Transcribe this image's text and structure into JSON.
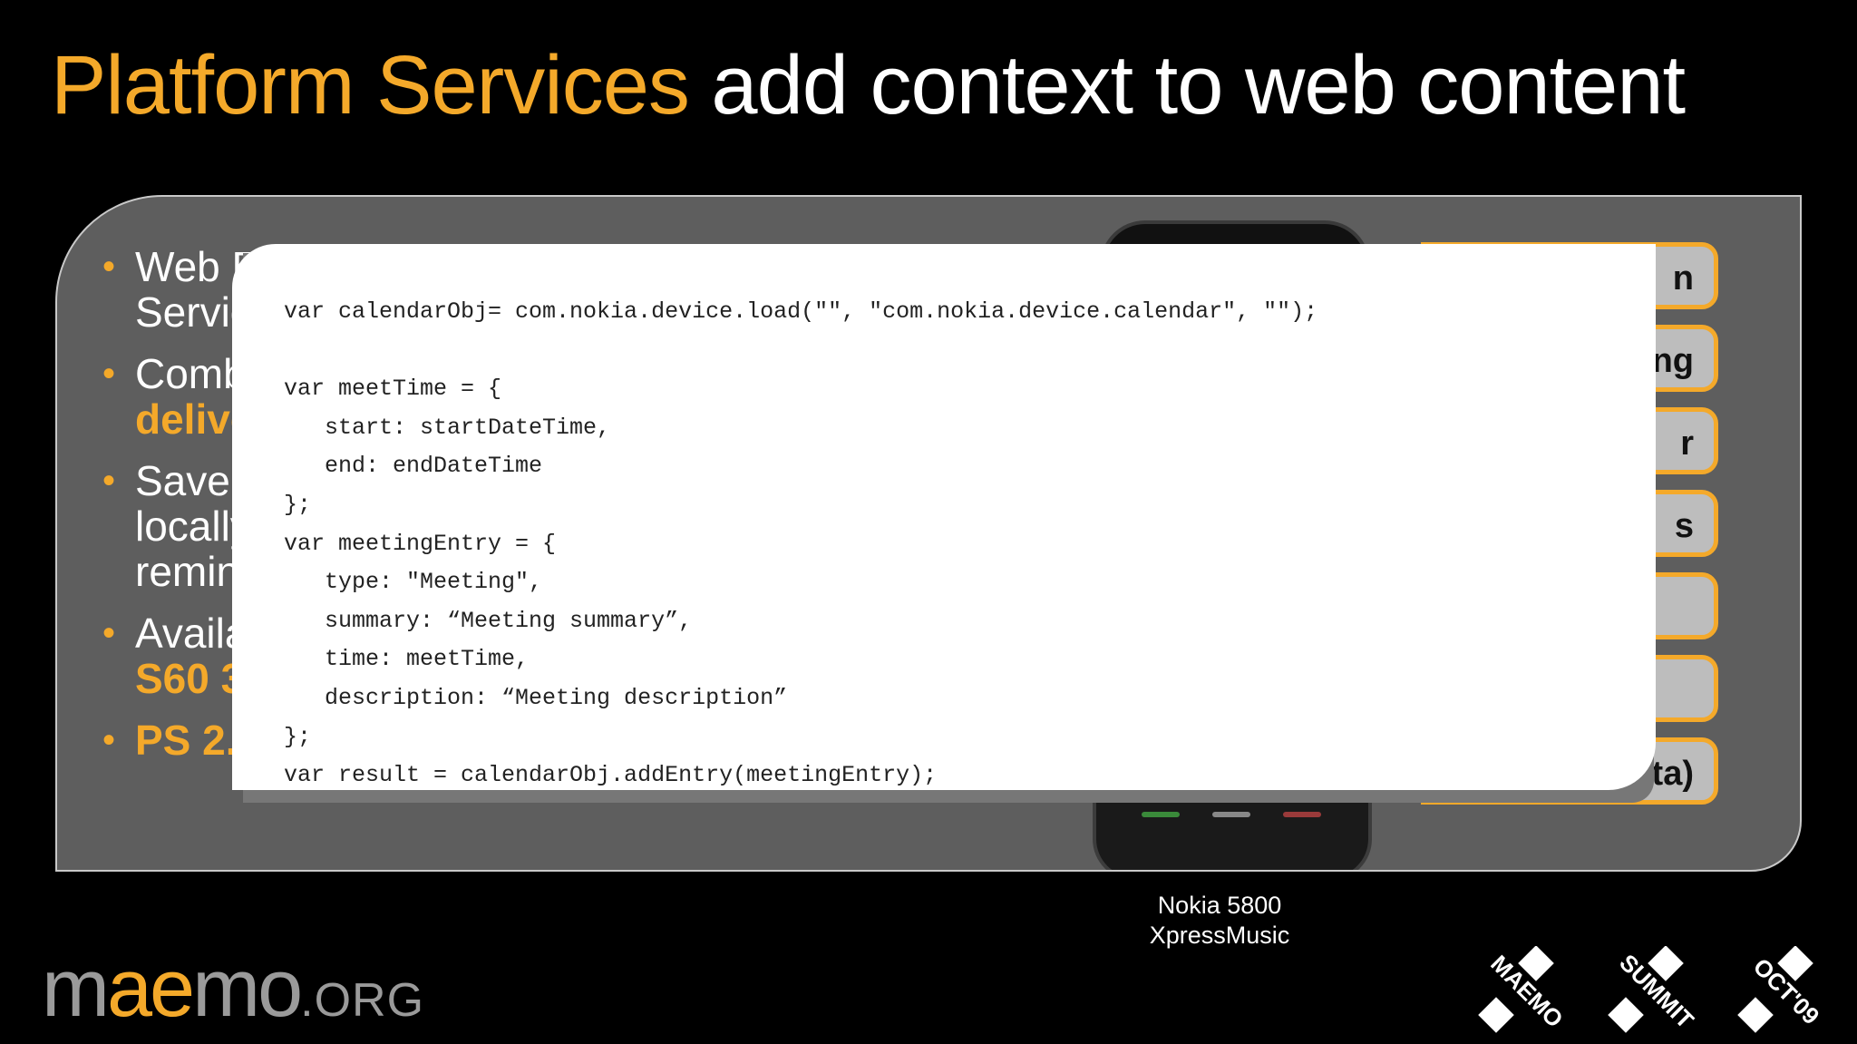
{
  "slide": {
    "title_highlight": "Platform Services",
    "title_rest": " add context to web content"
  },
  "bullets": [
    {
      "text": "Web F",
      "text2": "Servic"
    },
    {
      "text": "Comb",
      "text2": "delive"
    },
    {
      "text": "Save",
      "text2": "locally",
      "text3": "remin"
    },
    {
      "text": "Availa",
      "text2": "S60 3"
    },
    {
      "text": "PS 2."
    }
  ],
  "services": [
    {
      "label": "n"
    },
    {
      "label": "ng"
    },
    {
      "label": "r"
    },
    {
      "label": "s"
    },
    {
      "label": ""
    },
    {
      "label": ""
    },
    {
      "label": "a (beta)"
    }
  ],
  "code": {
    "text": "var calendarObj= com.nokia.device.load(\"\", \"com.nokia.device.calendar\", \"\");\n\nvar meetTime = {\n   start: startDateTime,\n   end: endDateTime\n};\nvar meetingEntry = {\n   type: \"Meeting\",\n   summary: “Meeting summary”,\n   time: meetTime,\n   description: “Meeting description”\n};\nvar result = calendarObj.addEntry(meetingEntry);"
  },
  "device_caption": {
    "line1": "Nokia 5800",
    "line2": "XpressMusic"
  },
  "footer": {
    "logo_pre": "m",
    "logo_ae": "ae",
    "logo_post": "mo",
    "logo_org": ".ORG",
    "badges": [
      "MAEMO",
      "SUMMIT",
      "OCT'09"
    ]
  },
  "colors": {
    "accent": "#f4a92a",
    "background": "#000000",
    "panel": "#5e5e5e"
  }
}
